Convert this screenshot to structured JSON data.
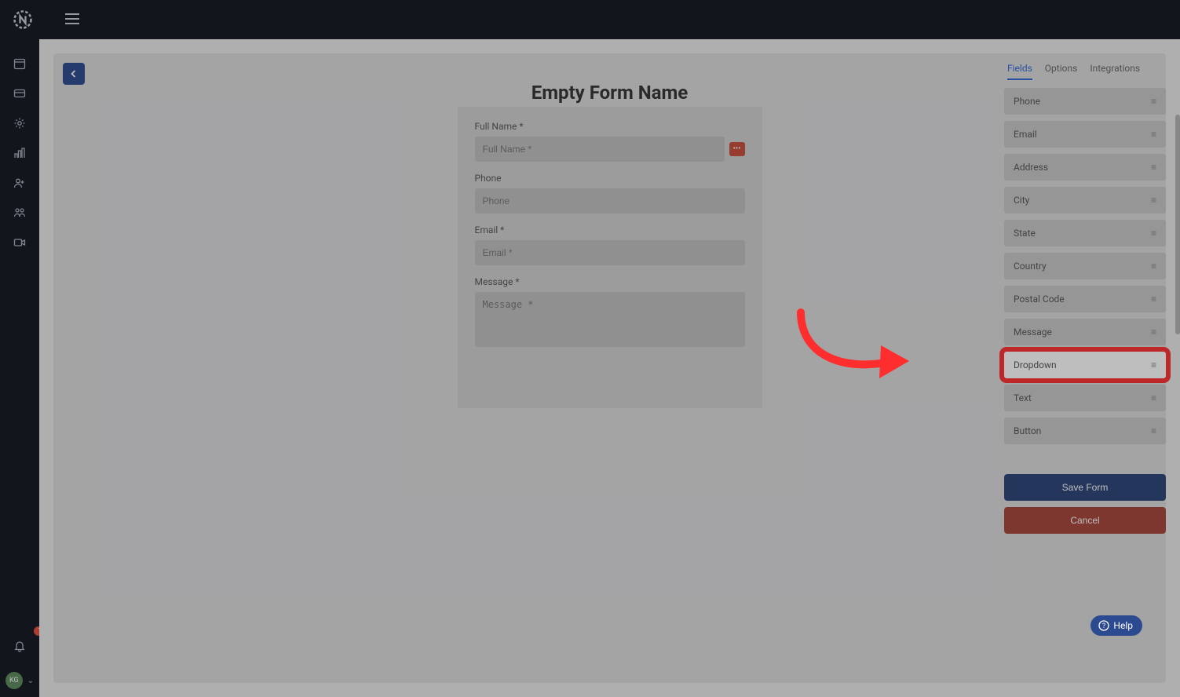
{
  "topbar": {
    "menu_icon": "menu-icon"
  },
  "sidebar": {
    "notification_count": "1",
    "avatar_initials": "KG"
  },
  "form": {
    "title": "Empty Form Name",
    "fields": [
      {
        "label": "Full Name *",
        "placeholder": "Full Name *",
        "has_more": true
      },
      {
        "label": "Phone",
        "placeholder": "Phone",
        "has_more": false
      },
      {
        "label": "Email *",
        "placeholder": "Email *",
        "has_more": false
      }
    ],
    "message_label": "Message *",
    "message_placeholder": "Message *"
  },
  "panel": {
    "tabs": [
      {
        "label": "Fields",
        "active": true
      },
      {
        "label": "Options",
        "active": false
      },
      {
        "label": "Integrations",
        "active": false
      }
    ],
    "available_fields": [
      "Phone",
      "Email",
      "Address",
      "City",
      "State",
      "Country",
      "Postal Code",
      "Message",
      "Dropdown",
      "Text",
      "Button"
    ],
    "highlight_index": 8,
    "save_label": "Save Form",
    "cancel_label": "Cancel"
  },
  "help_label": "Help"
}
